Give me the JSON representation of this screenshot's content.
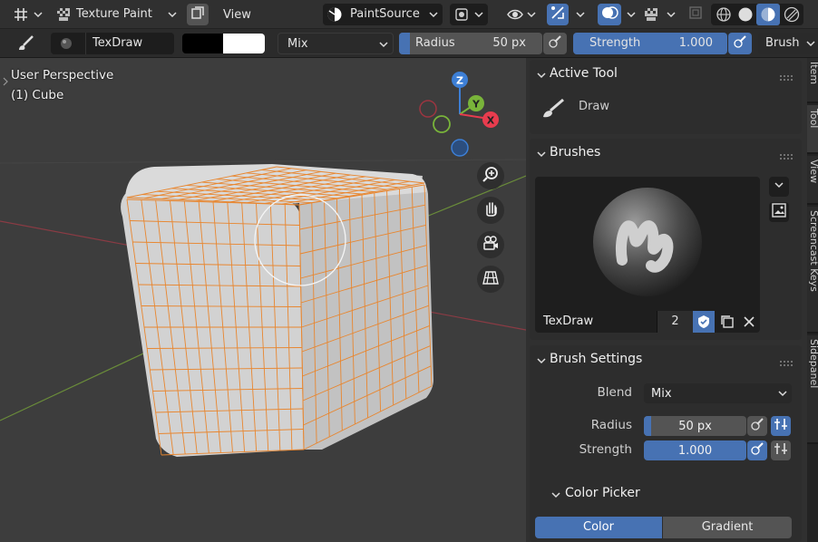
{
  "header": {
    "mode_label": "Texture Paint",
    "view_menu": "View",
    "paint_source": "PaintSource"
  },
  "tool_header": {
    "brush_name": "TexDraw",
    "blend": "Mix",
    "radius_label": "Radius",
    "radius_value": "50 px",
    "strength_label": "Strength",
    "strength_value": "1.000",
    "brush_menu": "Brush",
    "primary_color": "#000000",
    "secondary_color": "#ffffff"
  },
  "viewport": {
    "perspective": "User Perspective",
    "object": "(1) Cube",
    "gizmo": {
      "z": "Z",
      "y": "Y",
      "x": "X"
    },
    "nav_icons": [
      "zoom-icon",
      "hand-icon",
      "camera-icon",
      "grid-icon"
    ]
  },
  "sidebar": {
    "active_tool": {
      "title": "Active Tool",
      "tool": "Draw"
    },
    "brushes": {
      "title": "Brushes",
      "name": "TexDraw",
      "users": "2"
    },
    "brush_settings": {
      "title": "Brush Settings",
      "blend_label": "Blend",
      "blend_value": "Mix",
      "radius_label": "Radius",
      "radius_value": "50 px",
      "strength_label": "Strength",
      "strength_value": "1.000"
    },
    "color_picker": {
      "title": "Color Picker",
      "tab_color": "Color",
      "tab_gradient": "Gradient"
    },
    "tabs": [
      "Item",
      "Tool",
      "View",
      "Screencast Keys",
      "Sidepanel"
    ]
  },
  "colors": {
    "accent": "#4772b3",
    "wire": "#e8862f",
    "axis_x": "#e83c4e",
    "axis_y": "#79b43a",
    "axis_z": "#3d7fd6"
  }
}
